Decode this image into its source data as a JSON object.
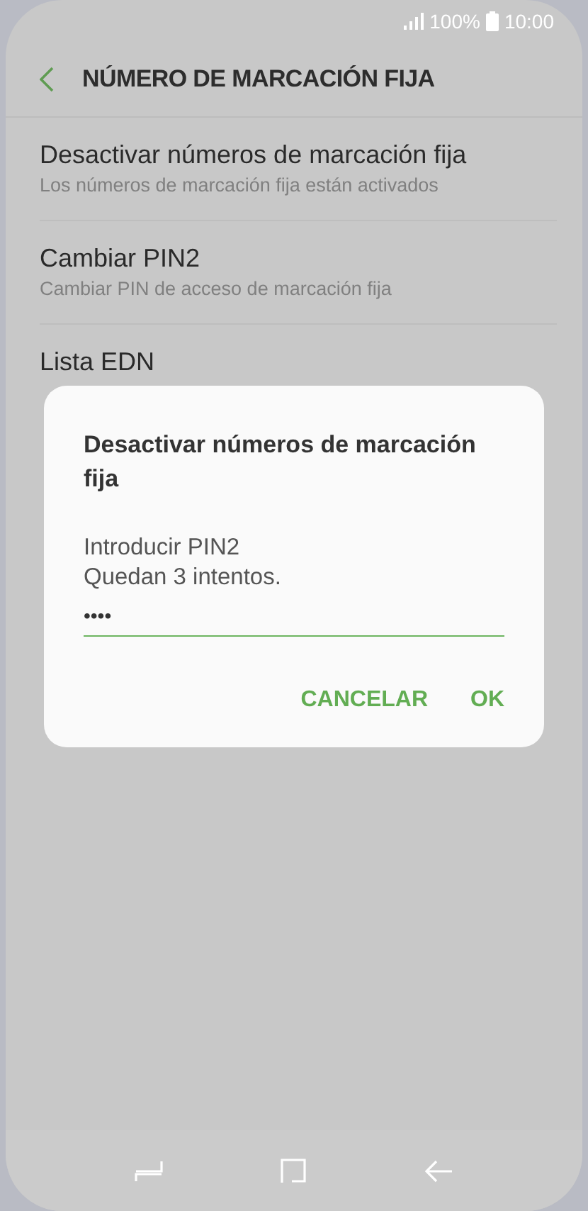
{
  "status_bar": {
    "battery": "100%",
    "time": "10:00"
  },
  "header": {
    "title": "NÚMERO DE MARCACIÓN FIJA"
  },
  "settings": [
    {
      "title": "Desactivar números de marcación fija",
      "subtitle": "Los números de marcación fija están activados"
    },
    {
      "title": "Cambiar PIN2",
      "subtitle": "Cambiar PIN de acceso de marcación fija"
    },
    {
      "title": "Lista EDN"
    }
  ],
  "dialog": {
    "title": "Desactivar números de marcación fija",
    "message": [
      "Introducir PIN2",
      "Quedan 3 intentos."
    ],
    "pin_value": "••••",
    "buttons": [
      "CANCELAR",
      "OK"
    ]
  }
}
